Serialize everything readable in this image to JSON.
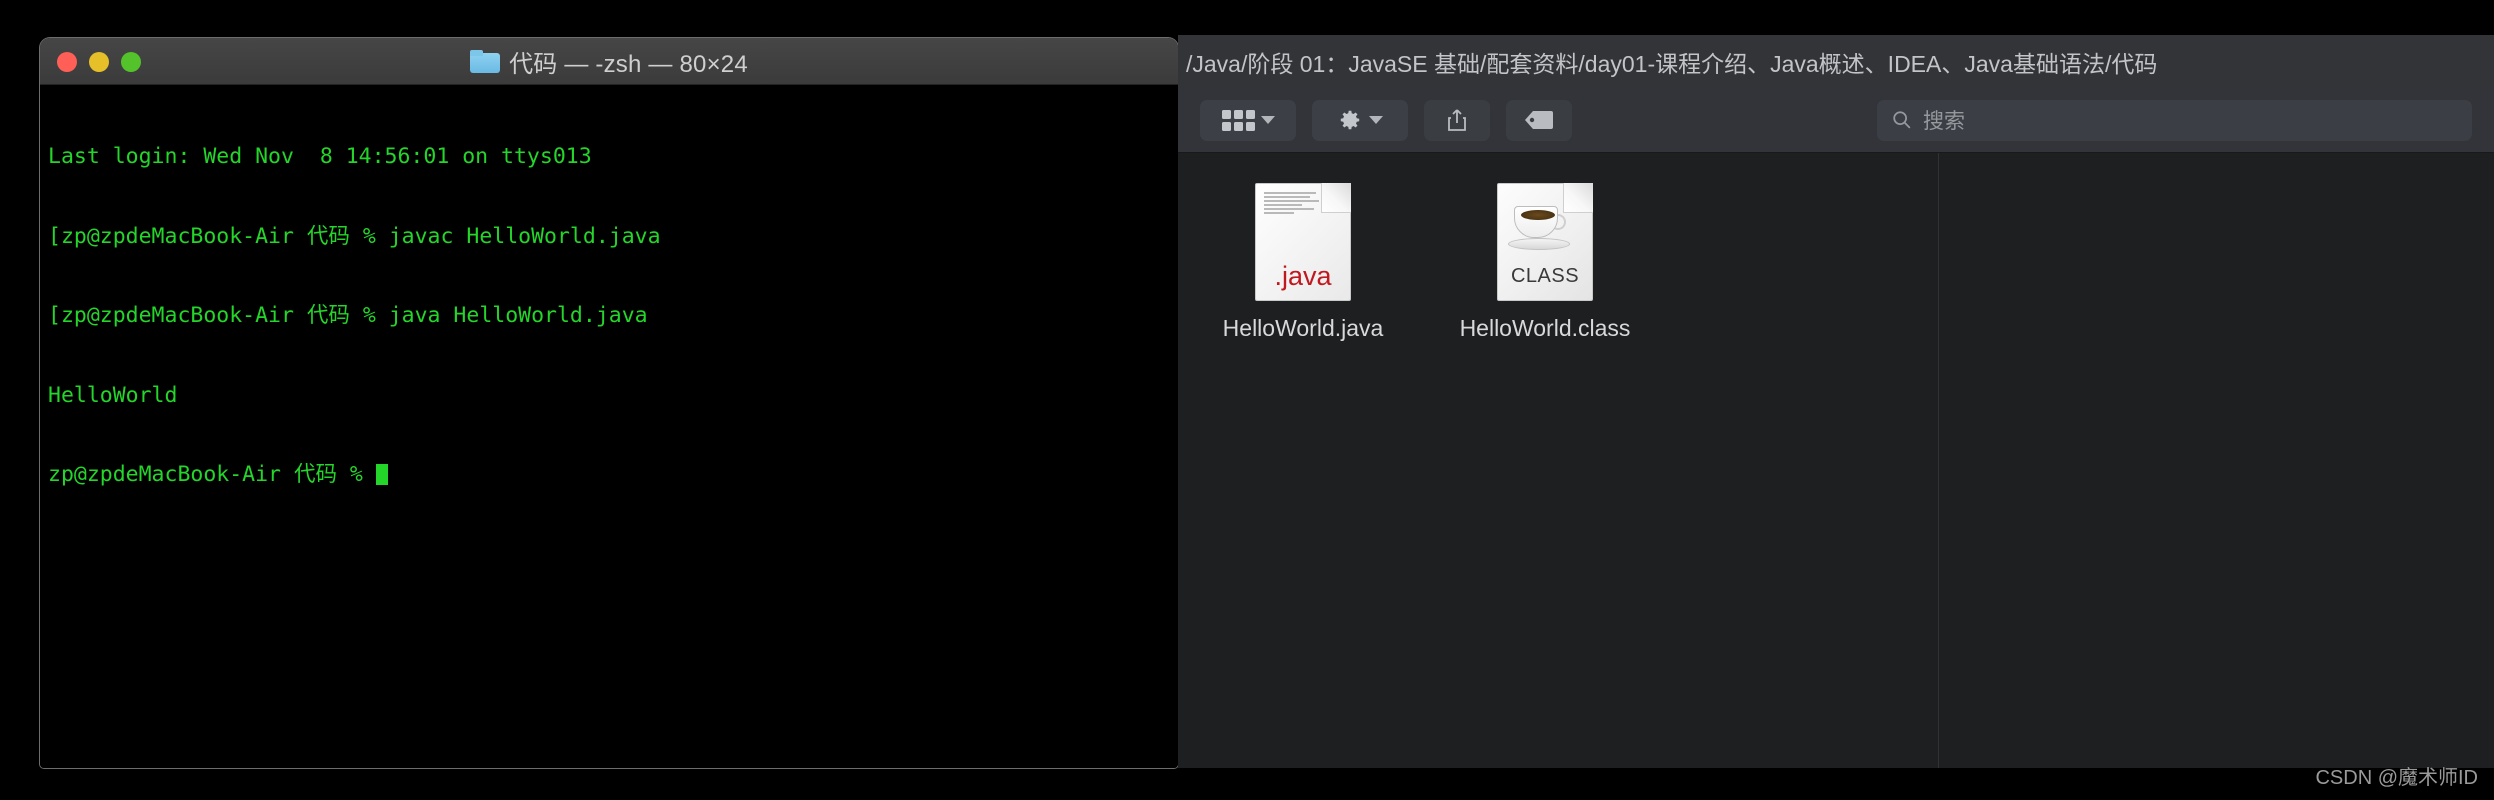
{
  "terminal": {
    "title": "代码 — -zsh — 80×24",
    "folder_icon": "folder-icon",
    "traffic_lights": {
      "close": "close-button",
      "minimize": "minimize-button",
      "maximize": "maximize-button"
    },
    "lines": [
      {
        "id": "line1",
        "text": "Last login: Wed Nov  8 14:56:01 on ttys013"
      },
      {
        "id": "line2",
        "text": "[zp@zpdeMacBook-Air 代码 % javac HelloWorld.java"
      },
      {
        "id": "line3",
        "text": "[zp@zpdeMacBook-Air 代码 % java HelloWorld.java"
      },
      {
        "id": "line4",
        "text": "HelloWorld"
      },
      {
        "id": "line5",
        "text": "zp@zpdeMacBook-Air 代码 % "
      }
    ],
    "colors": {
      "text": "#24d52a",
      "background": "#000000",
      "titlebar": "#3f3f3f"
    }
  },
  "finder": {
    "path": "/Java/阶段 01：JavaSE 基础/配套资料/day01-课程介绍、Java概述、IDEA、Java基础语法/代码",
    "toolbar": {
      "view_button": "icon-view-button",
      "view_chevron": "chevron-down-icon",
      "action_button": "gear-action-button",
      "action_chevron": "chevron-down-icon",
      "share_button": "share-button",
      "tag_button": "tag-button"
    },
    "search": {
      "placeholder": "搜索",
      "icon": "search-icon"
    },
    "files": [
      {
        "name": "HelloWorld.java",
        "icon_type": "java-document-icon",
        "badge": ".java"
      },
      {
        "name": "HelloWorld.class",
        "icon_type": "class-coffee-icon",
        "badge": "CLASS"
      }
    ],
    "colors": {
      "toolbar": "#32343a",
      "content": "#1e1f21",
      "java_red": "#c0181f"
    }
  },
  "watermark": {
    "text": "CSDN @魔术师ID"
  }
}
